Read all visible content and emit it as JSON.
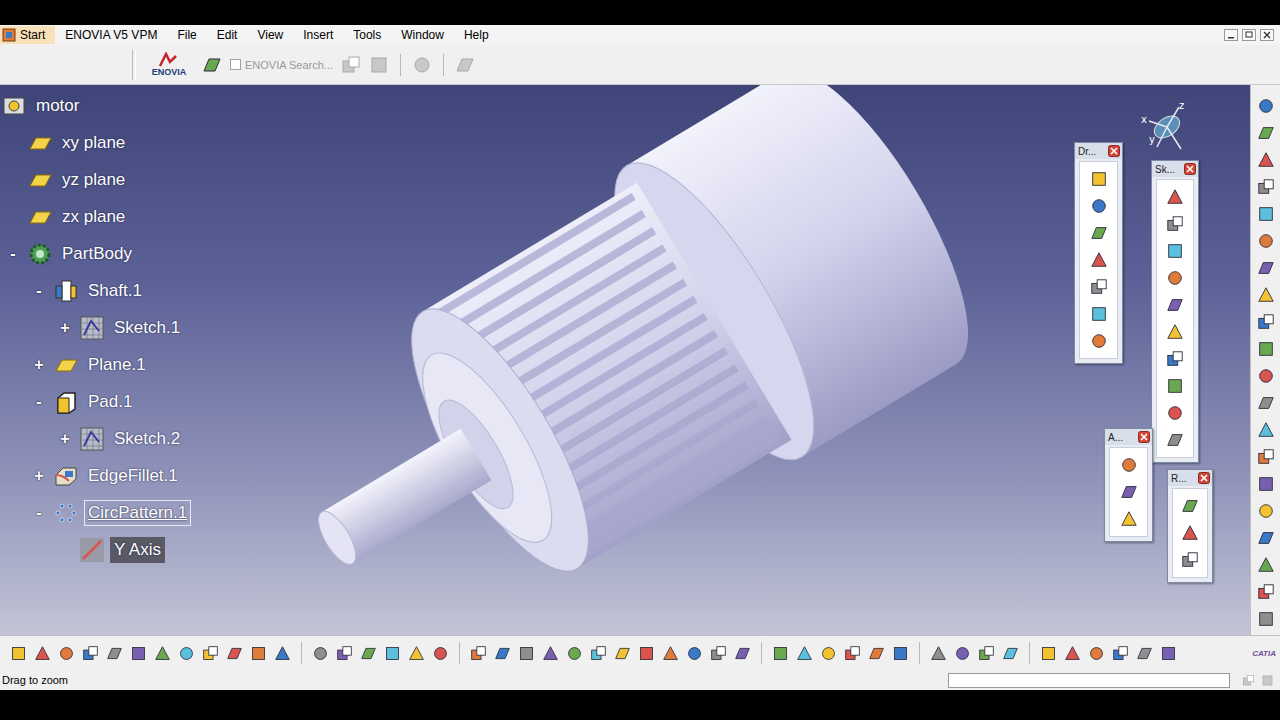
{
  "window": {
    "title": "motor"
  },
  "menu": [
    {
      "label": "Start",
      "selected": true
    },
    {
      "label": "ENOVIA V5 VPM",
      "selected": false
    },
    {
      "label": "File",
      "selected": false
    },
    {
      "label": "Edit",
      "selected": false
    },
    {
      "label": "View",
      "selected": false
    },
    {
      "label": "Insert",
      "selected": false
    },
    {
      "label": "Tools",
      "selected": false
    },
    {
      "label": "Window",
      "selected": false
    },
    {
      "label": "Help",
      "selected": false
    }
  ],
  "toolbar": {
    "logo": "ENOVIA",
    "search": {
      "placeholder": "ENOVIA Search...",
      "checked": false,
      "disabled": true
    }
  },
  "tree": [
    {
      "label": "motor",
      "depth": 0,
      "kind": "product",
      "toggle": "",
      "selected": false,
      "highlighted": false
    },
    {
      "label": "xy plane",
      "depth": 1,
      "kind": "plane",
      "toggle": "",
      "selected": false,
      "highlighted": false
    },
    {
      "label": "yz plane",
      "depth": 1,
      "kind": "plane",
      "toggle": "",
      "selected": false,
      "highlighted": false
    },
    {
      "label": "zx plane",
      "depth": 1,
      "kind": "plane",
      "toggle": "",
      "selected": false,
      "highlighted": false
    },
    {
      "label": "PartBody",
      "depth": 1,
      "kind": "body",
      "toggle": "-",
      "selected": false,
      "highlighted": false
    },
    {
      "label": "Shaft.1",
      "depth": 2,
      "kind": "shaft",
      "toggle": "-",
      "selected": false,
      "highlighted": false
    },
    {
      "label": "Sketch.1",
      "depth": 3,
      "kind": "sketch",
      "toggle": "+",
      "selected": false,
      "highlighted": false
    },
    {
      "label": "Plane.1",
      "depth": 2,
      "kind": "plane",
      "toggle": "+",
      "selected": false,
      "highlighted": false
    },
    {
      "label": "Pad.1",
      "depth": 2,
      "kind": "pad",
      "toggle": "-",
      "selected": false,
      "highlighted": false
    },
    {
      "label": "Sketch.2",
      "depth": 3,
      "kind": "sketch",
      "toggle": "+",
      "selected": false,
      "highlighted": false
    },
    {
      "label": "EdgeFillet.1",
      "depth": 2,
      "kind": "fillet",
      "toggle": "+",
      "selected": false,
      "highlighted": false
    },
    {
      "label": "CircPattern.1",
      "depth": 2,
      "kind": "pattern",
      "toggle": "-",
      "selected": true,
      "highlighted": false
    },
    {
      "label": "Y Axis",
      "depth": 3,
      "kind": "axis",
      "toggle": "",
      "selected": false,
      "highlighted": true
    }
  ],
  "compass": {
    "labels": [
      "x",
      "y",
      "z"
    ]
  },
  "floating_toolbars": [
    {
      "title": "Dr..."
    },
    {
      "title": "Sk..."
    },
    {
      "title": "A..."
    },
    {
      "title": "R..."
    }
  ],
  "bottom_toolbar": {
    "brand": "CATIA"
  },
  "status_bar": {
    "message": "Drag to zoom",
    "field": ""
  }
}
